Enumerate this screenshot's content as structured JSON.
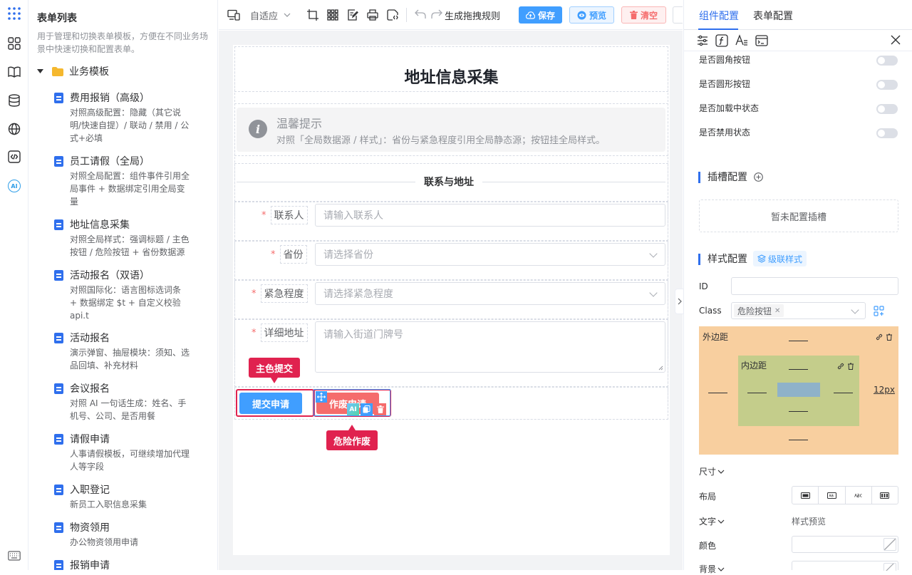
{
  "form_list": {
    "title": "表单列表",
    "description": "用于管理和切换表单模板，方便在不同业务场景中快速切换和配置表单。",
    "folder": "业务模板",
    "templates": [
      {
        "name": "费用报销（高级）",
        "desc": "对照高级配置：隐藏（其它说明/快速自提）/ 联动 / 禁用 / 公式+必填"
      },
      {
        "name": "员工请假（全局）",
        "desc": "对照全局配置：组件事件引用全局事件 + 数据绑定引用全局变量"
      },
      {
        "name": "地址信息采集",
        "desc": "对照全局样式：强调标题 / 主色按钮 / 危险按钮 + 省份数据源"
      },
      {
        "name": "活动报名（双语）",
        "desc": "对照国际化：语言图标选词条 + 数据绑定 $t + 自定义校验 api.t"
      },
      {
        "name": "活动报名",
        "desc": "演示弹窗、抽屉模块：须知、选品回填、补充材料"
      },
      {
        "name": "会议报名",
        "desc": "对照 AI 一句话生成：姓名、手机号、公司、是否用餐"
      },
      {
        "name": "请假申请",
        "desc": "人事请假模板，可继续增加代理人等字段"
      },
      {
        "name": "入职登记",
        "desc": "新员工入职信息采集"
      },
      {
        "name": "物资领用",
        "desc": "办公物资领用申请"
      },
      {
        "name": "报销申请",
        "desc": ""
      }
    ]
  },
  "toolbar": {
    "adaptive": "自适应",
    "generate_rules": "生成拖拽规则",
    "save": "保存",
    "preview": "预览",
    "clear": "清空"
  },
  "form": {
    "title": "地址信息采集",
    "alert_title": "温馨提示",
    "alert_desc": "对照「全局数据源 / 样式」：省份与紧急程度引用全局静态源；按钮挂全局样式。",
    "divider": "联系与地址",
    "fields": [
      {
        "label": "联系人",
        "placeholder": "请输入联系人",
        "required": "*"
      },
      {
        "label": "省份",
        "placeholder": "请选择省份",
        "required": "*"
      },
      {
        "label": "紧急程度",
        "placeholder": "请选择紧急程度",
        "required": "*"
      },
      {
        "label": "详细地址",
        "placeholder": "请输入街道门牌号",
        "required": "*"
      }
    ],
    "submit_button": "提交申请",
    "void_button": "作废申请",
    "tag_primary": "主色提交",
    "tag_danger": "危险作废",
    "ai_badge": "AI"
  },
  "right_panel": {
    "tabs": [
      "组件配置",
      "表单配置"
    ],
    "switches": [
      "是否圆角按钮",
      "是否圆形按钮",
      "是否加载中状态",
      "是否禁用状态"
    ],
    "slot_title": "插槽配置",
    "slot_empty": "暂未配置插槽",
    "style_title": "样式配置",
    "cascade_style": "级联样式",
    "id_label": "ID",
    "class_label": "Class",
    "class_tag": "危险按钮",
    "margin_label": "外边距",
    "padding_label": "内边距",
    "margin_right_value": "12px",
    "size_label": "尺寸",
    "layout_label": "布局",
    "text_label": "文字",
    "style_preview": "样式预览",
    "color_label": "颜色",
    "bg_label": "背景"
  },
  "rail_ai": "AI"
}
